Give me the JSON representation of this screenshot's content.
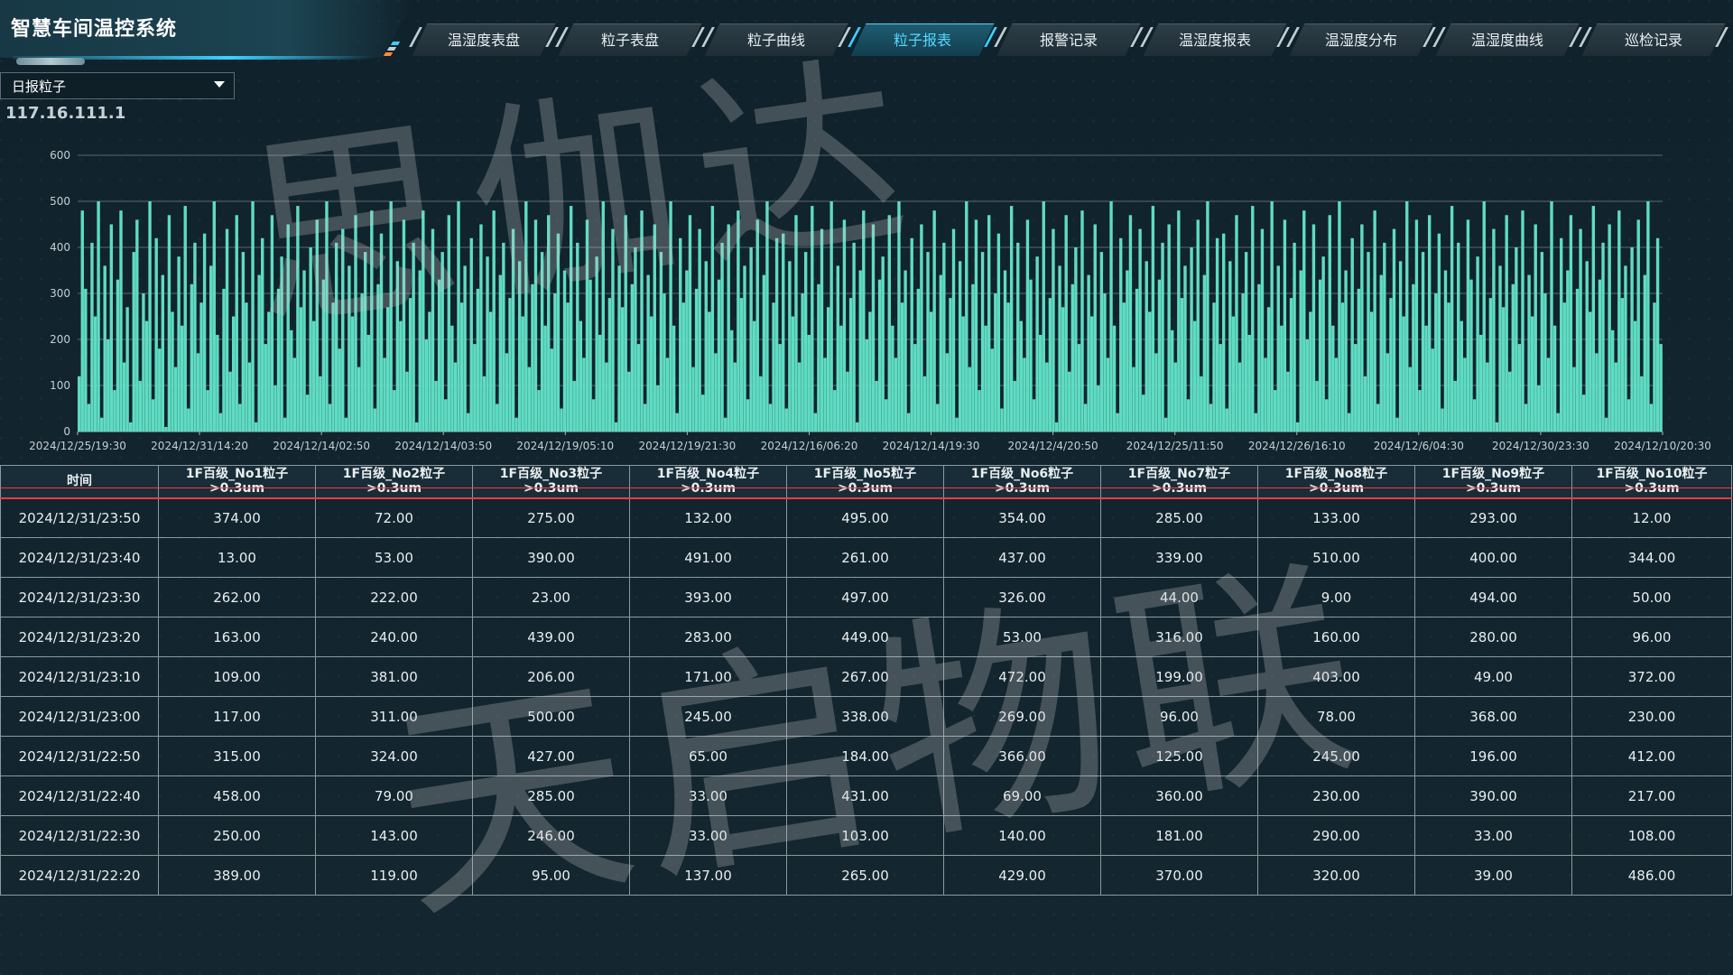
{
  "app": {
    "title": "智慧车间温控系统",
    "device_ip": "117.16.111.1"
  },
  "tabs": [
    {
      "label": "温湿度表盘",
      "active": false
    },
    {
      "label": "粒子表盘",
      "active": false
    },
    {
      "label": "粒子曲线",
      "active": false
    },
    {
      "label": "粒子报表",
      "active": true
    },
    {
      "label": "报警记录",
      "active": false
    },
    {
      "label": "温湿度报表",
      "active": false
    },
    {
      "label": "温湿度分布",
      "active": false
    },
    {
      "label": "温湿度曲线",
      "active": false
    },
    {
      "label": "巡检记录",
      "active": false
    }
  ],
  "report_select": {
    "value": "日报粒子"
  },
  "colors": {
    "series": "#5fdcc3",
    "accent": "#3ccfff",
    "header_row_line": "#ff3c3c",
    "background": "#12242f"
  },
  "chart_data": {
    "type": "bar",
    "title": "",
    "xlabel": "",
    "ylabel": "",
    "ylim": [
      0,
      600
    ],
    "yticks": [
      0,
      100,
      200,
      300,
      400,
      500,
      600
    ],
    "x_tick_labels": [
      "2024/12/25/19:30",
      "2024/12/31/14:20",
      "2024/12/14/02:50",
      "2024/12/14/03:50",
      "2024/12/19/05:10",
      "2024/12/19/21:30",
      "2024/12/16/06:20",
      "2024/12/14/19:30",
      "2024/12/4/20:50",
      "2024/12/25/11:50",
      "2024/12/26/16:10",
      "2024/12/6/04:30",
      "2024/12/30/23:30",
      "2024/12/10/20:30"
    ],
    "series": [
      {
        "values": [
          120,
          480,
          310,
          60,
          410,
          250,
          500,
          30,
          360,
          200,
          450,
          90,
          330,
          480,
          150,
          270,
          20,
          390,
          460,
          110,
          300,
          240,
          500,
          70,
          420,
          180,
          340,
          10,
          470,
          260,
          140,
          380,
          230,
          490,
          50,
          320,
          410,
          170,
          280,
          430,
          90,
          360,
          500,
          210,
          40,
          310,
          440,
          130,
          250,
          470,
          60,
          390,
          280,
          150,
          500,
          20,
          340,
          420,
          190,
          260,
          470,
          100,
          310,
          380,
          30,
          450,
          220,
          160,
          490,
          270,
          350,
          80,
          400,
          240,
          460,
          120,
          330,
          500,
          60,
          280,
          410,
          180,
          440,
          30,
          360,
          250,
          470,
          140,
          300,
          390,
          210,
          480,
          50,
          320,
          430,
          160,
          270,
          500,
          90,
          370,
          240,
          460,
          130,
          290,
          410,
          20,
          350,
          480,
          200,
          260,
          440,
          110,
          330,
          390,
          70,
          470,
          230,
          150,
          500,
          280,
          360,
          40,
          420,
          190,
          310,
          450,
          120,
          380,
          260,
          480,
          60,
          340,
          410,
          170,
          290,
          440,
          30,
          370,
          250,
          500,
          140,
          320,
          460,
          90,
          390,
          230,
          470,
          180,
          300,
          430,
          50,
          350,
          280,
          490,
          110,
          410,
          240,
          160,
          460,
          330,
          70,
          380,
          210,
          500,
          150,
          290,
          440,
          20,
          360,
          270,
          470,
          130,
          320,
          400,
          190,
          480,
          60,
          340,
          250,
          450,
          100,
          390,
          300,
          160,
          500,
          230,
          40,
          420,
          280,
          350,
          470,
          140,
          310,
          440,
          80,
          370,
          260,
          490,
          170,
          330,
          410,
          30,
          450,
          220,
          150,
          480,
          290,
          360,
          70,
          400,
          240,
          460,
          120,
          340,
          500,
          60,
          280,
          420,
          190,
          430,
          50,
          370,
          250,
          470,
          150,
          300,
          390,
          210,
          490,
          40,
          320,
          440,
          160,
          270,
          500,
          90,
          360,
          230,
          460,
          130,
          290,
          410,
          20,
          350,
          480,
          200,
          260,
          450,
          110,
          330,
          380,
          70,
          470,
          230,
          160,
          500,
          280,
          350,
          40,
          420,
          190,
          310,
          450,
          120,
          390,
          260,
          480,
          60,
          340,
          410,
          170,
          290,
          440,
          30,
          370,
          250,
          500,
          140,
          320,
          460,
          90,
          390,
          230,
          470,
          180,
          300,
          430,
          50,
          350,
          280,
          490,
          110,
          410,
          240,
          160,
          460,
          330,
          70,
          380,
          210,
          500,
          150,
          290,
          440,
          20,
          360,
          270,
          470,
          130,
          320,
          400,
          190,
          480,
          60,
          340,
          250,
          450,
          100,
          390,
          300,
          160,
          500,
          230,
          40,
          420,
          280,
          350,
          470,
          140,
          310,
          440,
          80,
          370,
          260,
          490,
          170,
          330,
          410,
          30,
          450,
          220,
          150,
          480,
          290,
          360,
          70,
          400,
          240,
          460,
          120,
          340,
          500,
          60,
          280,
          420,
          190,
          430,
          50,
          370,
          250,
          470,
          150,
          300,
          390,
          210,
          490,
          40,
          320,
          440,
          160,
          270,
          500,
          90,
          360,
          230,
          460,
          130,
          290,
          410,
          20,
          350,
          480,
          200,
          260,
          450,
          110,
          330,
          380,
          70,
          470,
          230,
          160,
          500,
          280,
          350,
          40,
          420,
          190,
          310,
          450,
          120,
          390,
          260,
          480,
          60,
          340,
          410,
          170,
          290,
          440,
          30,
          370,
          250,
          500,
          140,
          320,
          460,
          90,
          390,
          230,
          470,
          180,
          300,
          430,
          50,
          350,
          280,
          490,
          110,
          410,
          240,
          160,
          460,
          330,
          70,
          380,
          210,
          500,
          150,
          290,
          440,
          20,
          360,
          270,
          470,
          130,
          320,
          400,
          190,
          480,
          60,
          340,
          250,
          450,
          100,
          390,
          300,
          160,
          500,
          230,
          40,
          420,
          280,
          350,
          470,
          140,
          310,
          440,
          80,
          370,
          260,
          490,
          170,
          330,
          410,
          30,
          450,
          220,
          150,
          480,
          290,
          360,
          70,
          400,
          240,
          460,
          120,
          340,
          500,
          60,
          280,
          420,
          190
        ]
      }
    ]
  },
  "table": {
    "columns": [
      "时间",
      "1F百级_No1粒子>0.3um",
      "1F百级_No2粒子>0.3um",
      "1F百级_No3粒子>0.3um",
      "1F百级_No4粒子>0.3um",
      "1F百级_No5粒子>0.3um",
      "1F百级_No6粒子>0.3um",
      "1F百级_No7粒子>0.3um",
      "1F百级_No8粒子>0.3um",
      "1F百级_No9粒子>0.3um",
      "1F百级_No10粒子>0.3um"
    ],
    "rows": [
      [
        "2024/12/31/23:50",
        "374.00",
        "72.00",
        "275.00",
        "132.00",
        "495.00",
        "354.00",
        "285.00",
        "133.00",
        "293.00",
        "12.00"
      ],
      [
        "2024/12/31/23:40",
        "13.00",
        "53.00",
        "390.00",
        "491.00",
        "261.00",
        "437.00",
        "339.00",
        "510.00",
        "400.00",
        "344.00"
      ],
      [
        "2024/12/31/23:30",
        "262.00",
        "222.00",
        "23.00",
        "393.00",
        "497.00",
        "326.00",
        "44.00",
        "9.00",
        "494.00",
        "50.00"
      ],
      [
        "2024/12/31/23:20",
        "163.00",
        "240.00",
        "439.00",
        "283.00",
        "449.00",
        "53.00",
        "316.00",
        "160.00",
        "280.00",
        "96.00"
      ],
      [
        "2024/12/31/23:10",
        "109.00",
        "381.00",
        "206.00",
        "171.00",
        "267.00",
        "472.00",
        "199.00",
        "403.00",
        "49.00",
        "372.00"
      ],
      [
        "2024/12/31/23:00",
        "117.00",
        "311.00",
        "500.00",
        "245.00",
        "338.00",
        "269.00",
        "96.00",
        "78.00",
        "368.00",
        "230.00"
      ],
      [
        "2024/12/31/22:50",
        "315.00",
        "324.00",
        "427.00",
        "65.00",
        "184.00",
        "366.00",
        "125.00",
        "245.00",
        "196.00",
        "412.00"
      ],
      [
        "2024/12/31/22:40",
        "458.00",
        "79.00",
        "285.00",
        "33.00",
        "431.00",
        "69.00",
        "360.00",
        "230.00",
        "390.00",
        "217.00"
      ],
      [
        "2024/12/31/22:30",
        "250.00",
        "143.00",
        "246.00",
        "33.00",
        "103.00",
        "140.00",
        "181.00",
        "290.00",
        "33.00",
        "108.00"
      ],
      [
        "2024/12/31/22:20",
        "389.00",
        "119.00",
        "95.00",
        "137.00",
        "265.00",
        "429.00",
        "370.00",
        "320.00",
        "39.00",
        "486.00"
      ]
    ]
  },
  "watermarks": [
    "思伽达",
    "天启物联"
  ]
}
